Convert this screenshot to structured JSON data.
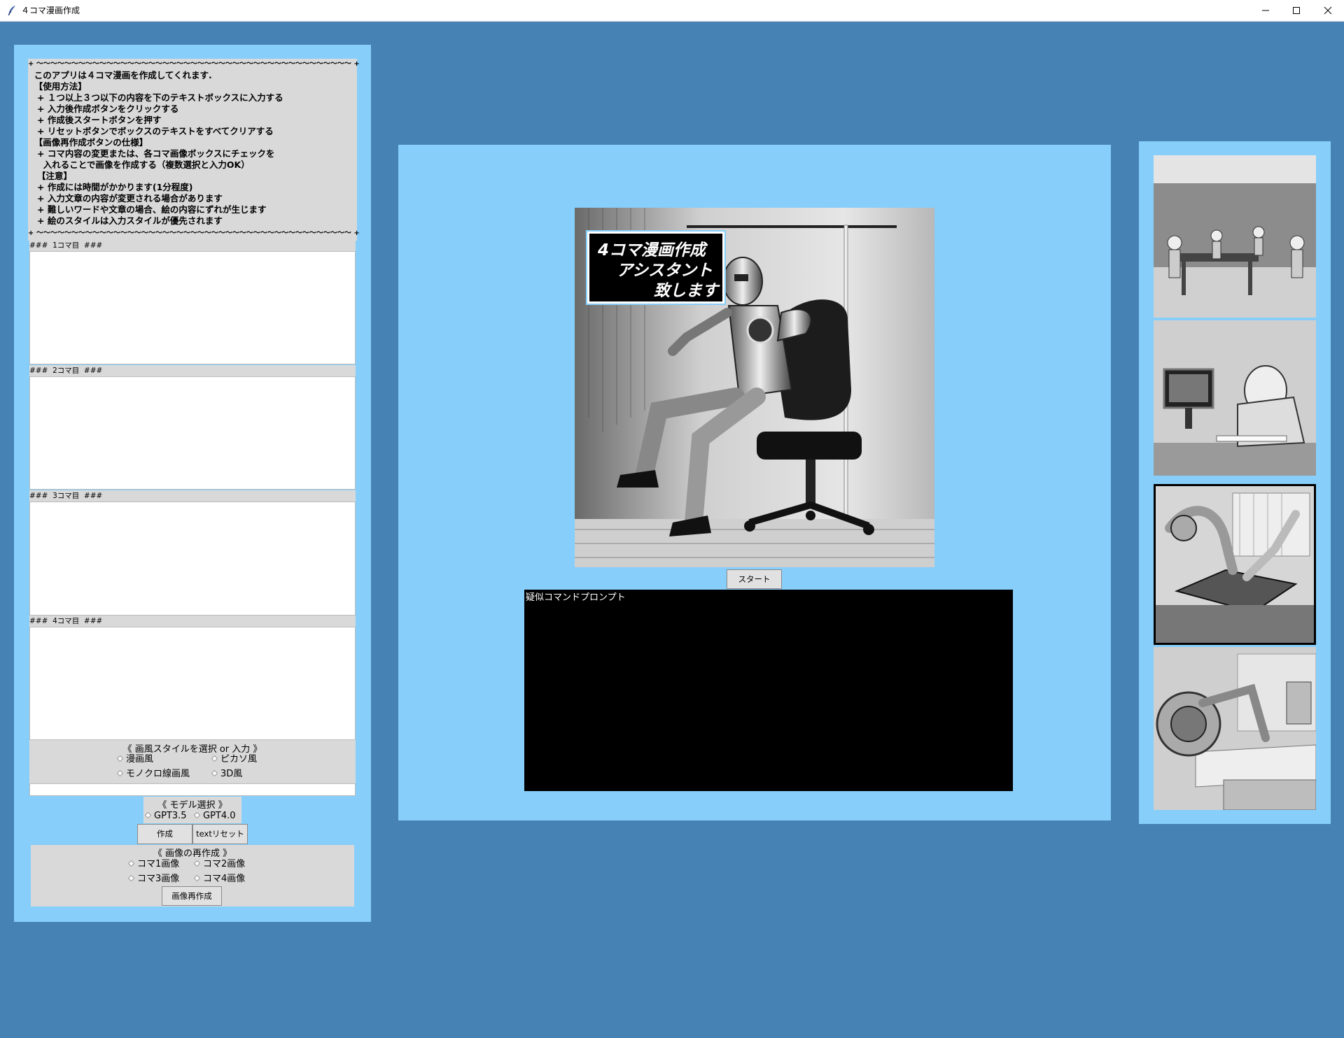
{
  "window": {
    "title": "４コマ漫画作成"
  },
  "instructions": {
    "lines": [
      "+ ～～～～～～～～～～～～～～～～～～～～～～～～～～～～～～～～～～～～～～～～～～～～～ +",
      "  このアプリは４コマ漫画を作成してくれます.",
      "  【使用方法】",
      "   + １つ以上３つ以下の内容を下のテキストボックスに入力する",
      "   + 入力後作成ボタンをクリックする",
      "   + 作成後スタートボタンを押す",
      "   + リセットボタンでボックスのテキストをすべてクリアする",
      "  【画像再作成ボタンの仕様】",
      "   + コマ内容の変更または、各コマ画像ボックスにチェックを",
      "     入れることで画像を作成する（複数選択と入力OK）",
      "   【注意】",
      "   + 作成には時間がかかります(1分程度)",
      "   + 入力文章の内容が変更される場合があります",
      "   + 難しいワードや文章の場合、絵の内容にずれが生じます",
      "   + 絵のスタイルは入力スタイルが優先されます",
      "+ ～～～～～～～～～～～～～～～～～～～～～～～～～～～～～～～～～～～～～～～～～～～～～ +"
    ]
  },
  "panels": [
    {
      "label": "###  1コマ目  ###",
      "value": ""
    },
    {
      "label": "###  2コマ目  ###",
      "value": ""
    },
    {
      "label": "###  3コマ目  ###",
      "value": ""
    },
    {
      "label": "###  4コマ目  ###",
      "value": ""
    }
  ],
  "style_select": {
    "title": "《 画風スタイルを選択 or 入力 》",
    "options": [
      "漫画風",
      "ピカソ風",
      "モノクロ線画風",
      "3D風"
    ],
    "input_value": ""
  },
  "model_select": {
    "title": "《 モデル選択 》",
    "options": [
      "GPT3.5",
      "GPT4.0"
    ]
  },
  "buttons": {
    "create": "作成",
    "reset": "textリセット",
    "regenerate": "画像再作成",
    "start": "スタート"
  },
  "regen": {
    "title": "《 画像の再作成 》",
    "options": [
      "コマ1画像",
      "コマ2画像",
      "コマ3画像",
      "コマ4画像"
    ]
  },
  "main_image": {
    "caption_lines": [
      "4コマ漫画作成",
      "アシスタント",
      "致します"
    ]
  },
  "console": {
    "text": "疑似コマンドプロンプト"
  },
  "thumbnails": [
    "robots-at-meeting-table-image",
    "robot-writing-at-desk-image",
    "robot-arm-drawing-image",
    "robot-at-drafting-desk-image"
  ]
}
